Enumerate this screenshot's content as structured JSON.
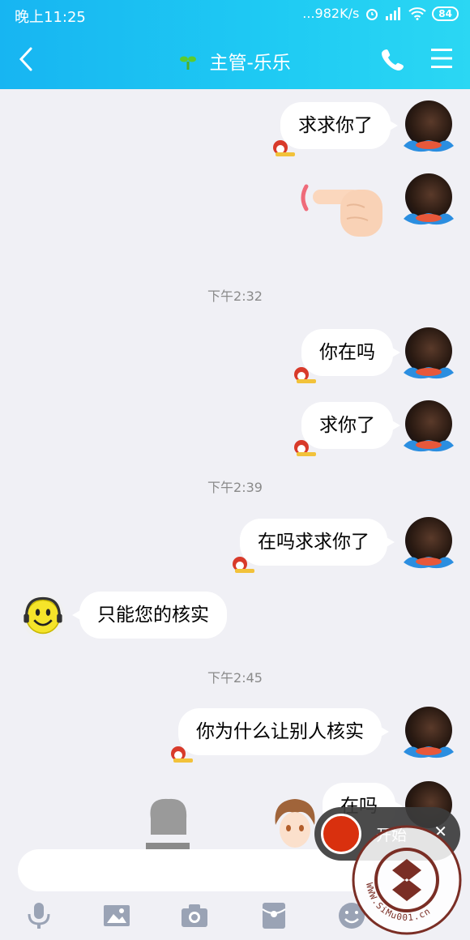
{
  "status": {
    "time": "晚上11:25",
    "speed": "982K/s",
    "battery": "84"
  },
  "header": {
    "title": "主管-乐乐"
  },
  "messages": [
    {
      "text": "求求你了"
    },
    {
      "text": "你在吗"
    },
    {
      "text": "求你了"
    },
    {
      "text": "在吗求求你了"
    },
    {
      "text": "只能您的核实"
    },
    {
      "text": "你为什么让别人核实"
    },
    {
      "text": "在吗"
    }
  ],
  "timestamps": [
    "下午2:32",
    "下午2:39",
    "下午2:45"
  ],
  "recorder": {
    "label": "开始",
    "close": "✕"
  },
  "watermark": {
    "text": "WWW.SiMu001.cn"
  },
  "colors": {
    "header_start": "#17b5f2",
    "header_end": "#2bd7f3",
    "record": "#d9300e"
  },
  "icons": [
    "back-icon",
    "sprout-icon",
    "phone-icon",
    "menu-icon",
    "mic-icon",
    "image-icon",
    "camera-icon",
    "red-packet-icon",
    "emoji-icon"
  ]
}
